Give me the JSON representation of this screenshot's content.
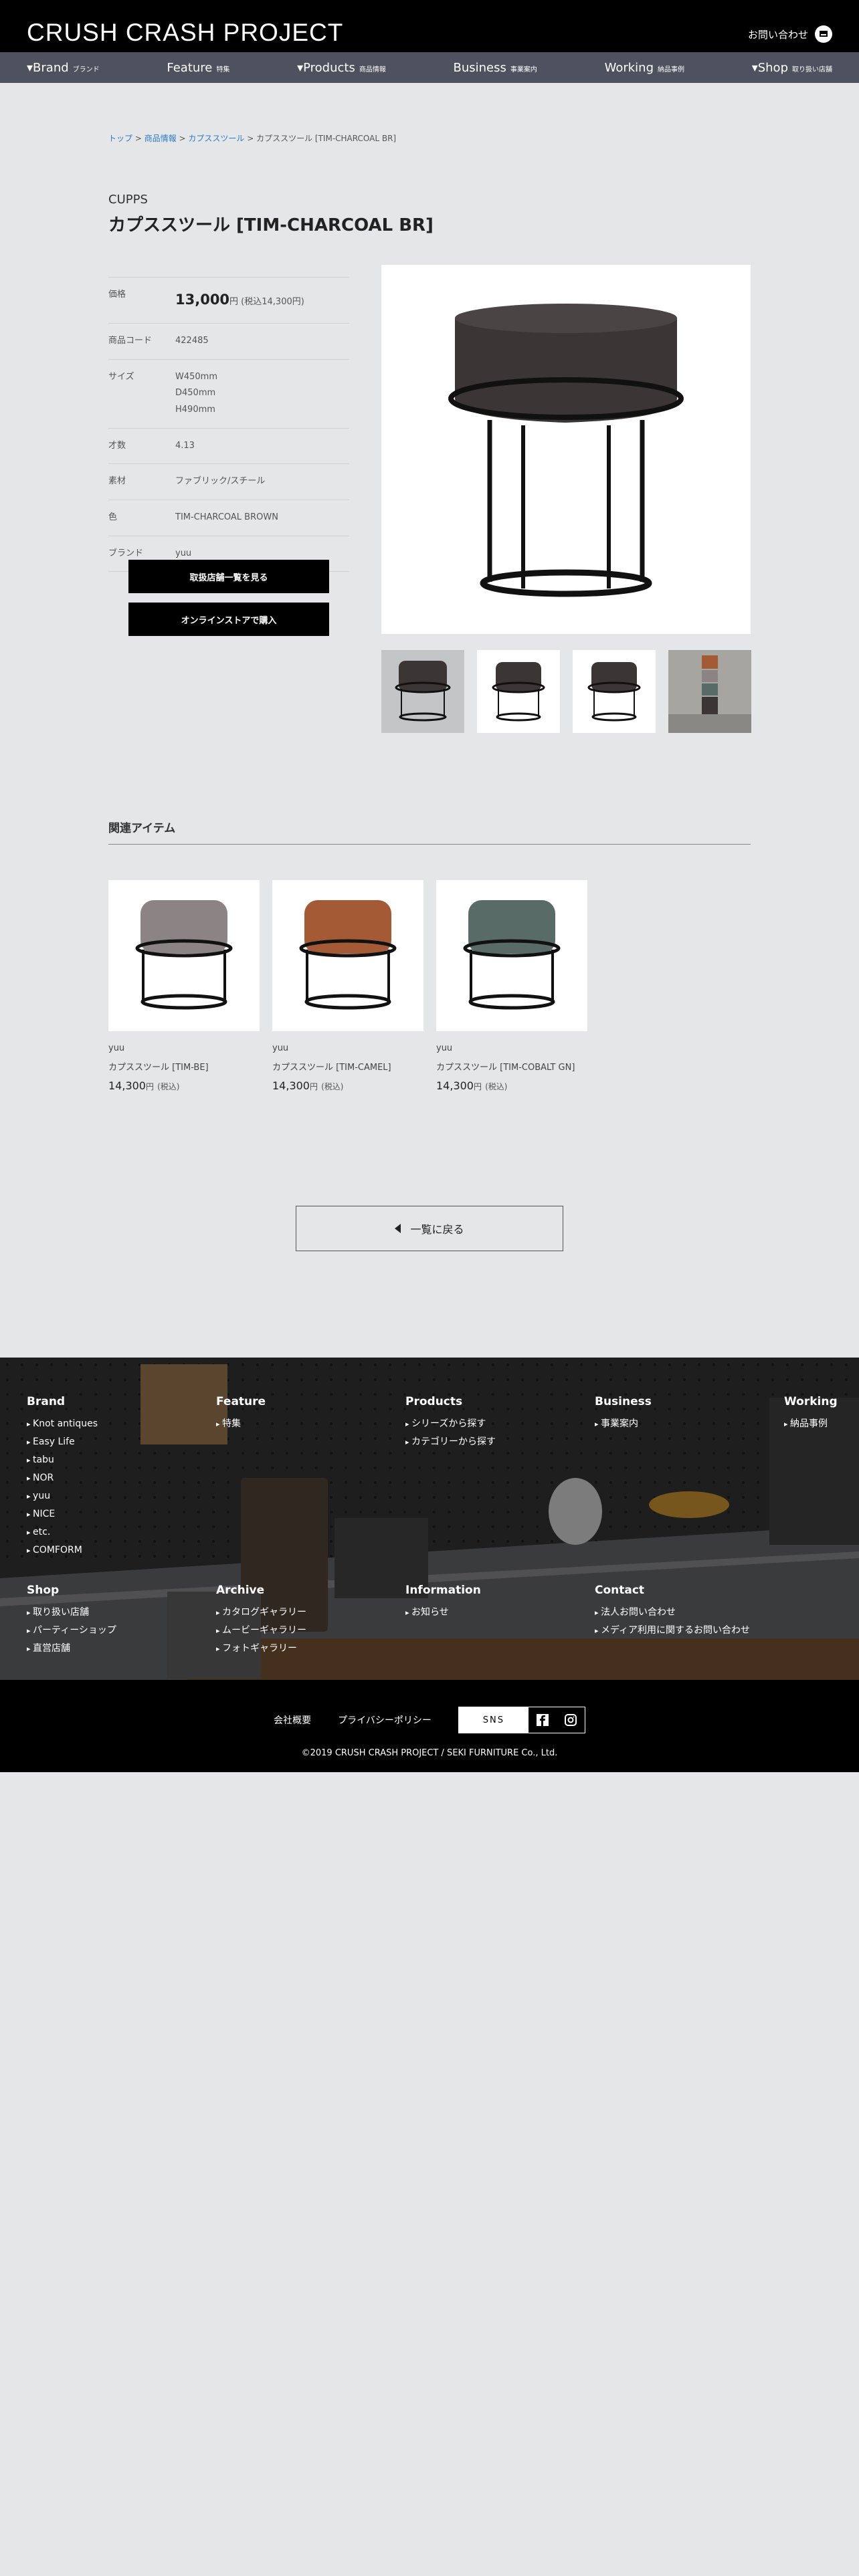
{
  "header": {
    "logo": "CRUSH CRASH PROJECT",
    "contact_label": "お問い合わせ"
  },
  "nav": [
    {
      "label": "▾Brand",
      "sub": "ブランド"
    },
    {
      "label": "Feature",
      "sub": "特集"
    },
    {
      "label": "▾Products",
      "sub": "商品情報"
    },
    {
      "label": "Business",
      "sub": "事業案内"
    },
    {
      "label": "Working",
      "sub": "納品事例"
    },
    {
      "label": "▾Shop",
      "sub": "取り扱い店舗"
    }
  ],
  "breadcrumb": {
    "items": [
      "トップ",
      "商品情報",
      "カプススツール"
    ],
    "separator": " > ",
    "current": "カプススツール [TIM-CHARCOAL BR]"
  },
  "product": {
    "brand_label": "CUPPS",
    "title": "カプススツール [TIM-CHARCOAL BR]",
    "spec": [
      {
        "key": "価格",
        "value": "13,000",
        "unit": "円 (税込14,300円)"
      },
      {
        "key": "商品コード",
        "value": "422485"
      },
      {
        "key": "サイズ",
        "lines": [
          "W450mm",
          "D450mm",
          "H490mm"
        ]
      },
      {
        "key": "才数",
        "value": "4.13"
      },
      {
        "key": "素材",
        "value": "ファブリック/スチール"
      },
      {
        "key": "色",
        "value": "TIM-CHARCOAL BROWN"
      },
      {
        "key": "ブランド",
        "value": "yuu"
      }
    ],
    "btn_stores": "取扱店舗一覧を見る",
    "btn_online": "オンラインストアで購入",
    "main_color": "#3b3535"
  },
  "related": {
    "title": "関連アイテム",
    "items": [
      {
        "brand": "yuu",
        "name": "カプススツール [TIM-BE]",
        "price": "14,300",
        "unit": "円",
        "tax": "(税込)",
        "color": "#8c8385"
      },
      {
        "brand": "yuu",
        "name": "カプススツール [TIM-CAMEL]",
        "price": "14,300",
        "unit": "円",
        "tax": "(税込)",
        "color": "#a55a36"
      },
      {
        "brand": "yuu",
        "name": "カプススツール [TIM-COBALT GN]",
        "price": "14,300",
        "unit": "円",
        "tax": "(税込)",
        "color": "#596b66"
      }
    ]
  },
  "back_label": "一覧に戻る",
  "footer": {
    "columns": [
      {
        "title": "Brand",
        "items": [
          "Knot antiques",
          "Easy Life",
          "tabu",
          "NOR",
          "yuu",
          "NICE",
          "etc.",
          "COMFORM"
        ]
      },
      {
        "title": "Feature",
        "items": [
          "特集"
        ]
      },
      {
        "title": "Products",
        "items": [
          "シリーズから探す",
          "カテゴリーから探す"
        ]
      },
      {
        "title": "Business",
        "items": [
          "事業案内"
        ]
      },
      {
        "title": "Working",
        "items": [
          "納品事例"
        ]
      },
      {
        "title": "Shop",
        "items": [
          "取り扱い店舗",
          "パーティーショップ",
          "直営店舗"
        ]
      },
      {
        "title": "Archive",
        "items": [
          "カタログギャラリー",
          "ムービーギャラリー",
          "フォトギャラリー"
        ]
      },
      {
        "title": "Information",
        "items": [
          "お知らせ"
        ]
      },
      {
        "title": "Contact",
        "items": [
          "法人お問い合わせ",
          "メディア利用に関するお問い合わせ"
        ]
      }
    ],
    "company": "会社概要",
    "privacy": "プライバシーポリシー",
    "sns_label": "SNS",
    "copyright": "©2019 CRUSH CRASH PROJECT / SEKI FURNITURE Co., Ltd."
  }
}
